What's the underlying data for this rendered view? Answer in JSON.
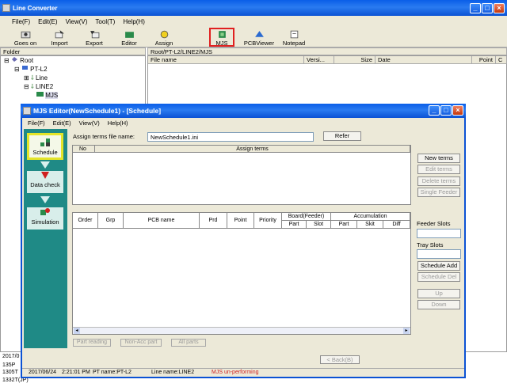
{
  "main_window": {
    "title": "Line Converter",
    "menu": [
      "File(F)",
      "Edit(E)",
      "View(V)",
      "Tool(T)",
      "Help(H)"
    ],
    "toolbar": [
      "Goes on",
      "Import",
      "Export",
      "Editor",
      "Assign",
      "MJS",
      "PCBViewer",
      "Notepad"
    ],
    "folder_header": "Folder",
    "path": "Root/PT-L2/LINE2/MJS",
    "file_columns": [
      "File name",
      "Versi...",
      "Size",
      "Date",
      "Point",
      "C"
    ],
    "tree": {
      "root": "Root",
      "pt": "PT-L2",
      "line": "Line",
      "line2": "LINE2",
      "mjs": "MJS"
    },
    "behind_items": [
      "2017/0",
      "135P",
      "1305T",
      "1332T(JP)"
    ]
  },
  "editor": {
    "title": "MJS Editor(NewSchedule1) - [Schedule]",
    "menu": [
      "File(F)",
      "Edit(E)",
      "View(V)",
      "Help(H)"
    ],
    "sidebar": {
      "schedule": "Schedule",
      "data_check": "Data check",
      "simulation": "Simulation"
    },
    "assign_label": "Assign terms file name:",
    "assign_value": "NewSchedule1.ini",
    "refer": "Refer",
    "terms_no": "No",
    "terms_header": "Assign terms",
    "right_buttons": [
      "New terms",
      "Edit terms",
      "Delete terms",
      "Single Feeder"
    ],
    "feeder_slots": "Feeder Slots",
    "tray_slots": "Tray Slots",
    "sched_buttons": [
      "Schedule Add",
      "Schedule Del",
      "Up",
      "Down"
    ],
    "grid": {
      "order": "Order",
      "grp": "Grp",
      "pcb": "PCB name",
      "prd": "Prd",
      "point": "Point",
      "priority": "Priority",
      "board": "Board(Feeder)",
      "accum": "Accumulation",
      "part": "Part",
      "slot": "Slot",
      "skit": "Skit",
      "diff": "Diff"
    },
    "bottom_buttons": [
      "Part reading",
      "Non-Acc part",
      "All parts"
    ],
    "back": "< Back(B)"
  },
  "status": {
    "date": "2017/06/24",
    "time": "2:21:01 PM",
    "pt": "PT name:PT-L2",
    "line": "Line name:LINE2",
    "state": "MJS un-performing"
  }
}
